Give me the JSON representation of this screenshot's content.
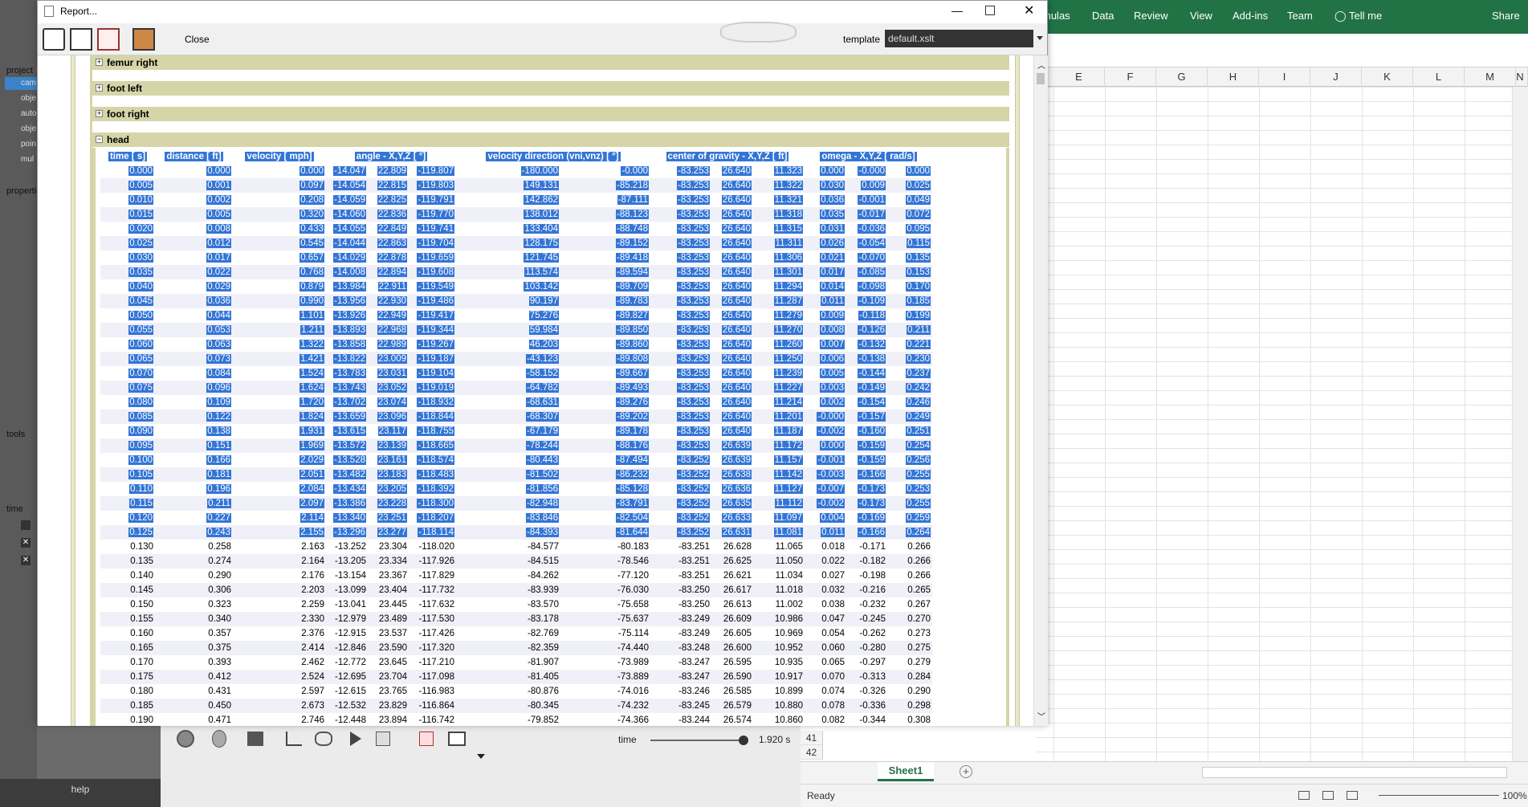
{
  "excel": {
    "tabs": [
      "mulas",
      "Data",
      "Review",
      "View",
      "Add-ins",
      "Team",
      "Tell me",
      "Share"
    ],
    "columns": [
      "E",
      "F",
      "G",
      "H",
      "I",
      "J",
      "K",
      "L",
      "M",
      "N"
    ],
    "row_numbers": [
      "41",
      "42"
    ],
    "sheet_tab": "Sheet1",
    "status": "Ready",
    "zoom": "100%"
  },
  "app": {
    "panel_labels": {
      "project": "project",
      "properties": "properties",
      "tools": "tools",
      "time": "time"
    },
    "project_items": [
      "cam",
      "obje",
      "auto",
      "obje",
      "poin",
      "mul"
    ],
    "help": "help",
    "time_label": "time",
    "time_value": "1.920 s",
    "time_slider_fraction": 0.97
  },
  "dialog": {
    "title": "Report...",
    "close_label": "Close",
    "template_label": "template",
    "template_value": "default.xslt",
    "sections": [
      "femur right",
      "foot left",
      "foot right",
      "head"
    ],
    "headers": [
      "time [ s]",
      "distance [ ft]",
      "velocity [ mph]",
      "angle - X,Y,Z [ °]",
      "velocity direction (vni,vnz) [ °]",
      "center of gravity - X,Y,Z [ ft]",
      "omega - X,Y,Z [ rad/s]"
    ],
    "selected_rows": 26,
    "rows": [
      [
        "0.000",
        "0.000",
        "0.000",
        "-14.047",
        "22.809",
        "-119.807",
        "-180.000",
        "-0.000",
        "-83.253",
        "26.640",
        "11.323",
        "0.000",
        "-0.000",
        "0.000"
      ],
      [
        "0.005",
        "0.001",
        "0.097",
        "-14.054",
        "22.815",
        "-119.803",
        "149.131",
        "-85.218",
        "-83.253",
        "26.640",
        "11.322",
        "0.030",
        "0.009",
        "0.025"
      ],
      [
        "0.010",
        "0.002",
        "0.208",
        "-14.059",
        "22.825",
        "-119.791",
        "142.862",
        "-87.111",
        "-83.253",
        "26.640",
        "11.321",
        "0.036",
        "-0.001",
        "0.049"
      ],
      [
        "0.015",
        "0.005",
        "0.320",
        "-14.060",
        "22.836",
        "-119.770",
        "138.012",
        "-88.123",
        "-83.253",
        "26.640",
        "11.318",
        "0.035",
        "-0.017",
        "0.072"
      ],
      [
        "0.020",
        "0.008",
        "0.433",
        "-14.055",
        "22.849",
        "-119.741",
        "133.404",
        "-88.748",
        "-83.253",
        "26.640",
        "11.315",
        "0.031",
        "-0.036",
        "0.095"
      ],
      [
        "0.025",
        "0.012",
        "0.545",
        "-14.044",
        "22.863",
        "-119.704",
        "128.175",
        "-89.152",
        "-83.253",
        "26.640",
        "11.311",
        "0.026",
        "-0.054",
        "0.115"
      ],
      [
        "0.030",
        "0.017",
        "0.657",
        "-14.029",
        "22.878",
        "-119.659",
        "121.745",
        "-89.418",
        "-83.253",
        "26.640",
        "11.306",
        "0.021",
        "-0.070",
        "0.135"
      ],
      [
        "0.035",
        "0.022",
        "0.768",
        "-14.008",
        "22.894",
        "-119.608",
        "113.574",
        "-89.594",
        "-83.253",
        "26.640",
        "11.301",
        "0.017",
        "-0.085",
        "0.153"
      ],
      [
        "0.040",
        "0.029",
        "0.879",
        "-13.984",
        "22.911",
        "-119.549",
        "103.142",
        "-89.709",
        "-83.253",
        "26.640",
        "11.294",
        "0.014",
        "-0.098",
        "0.170"
      ],
      [
        "0.045",
        "0.036",
        "0.990",
        "-13.956",
        "22.930",
        "-119.486",
        "90.197",
        "-89.783",
        "-83.253",
        "26.640",
        "11.287",
        "0.011",
        "-0.109",
        "0.185"
      ],
      [
        "0.050",
        "0.044",
        "1.101",
        "-13.926",
        "22.949",
        "-119.417",
        "75.276",
        "-89.827",
        "-83.253",
        "26.640",
        "11.279",
        "0.009",
        "-0.118",
        "0.199"
      ],
      [
        "0.055",
        "0.053",
        "1.211",
        "-13.893",
        "22.968",
        "-119.344",
        "59.984",
        "-89.850",
        "-83.253",
        "26.640",
        "11.270",
        "0.008",
        "-0.126",
        "0.211"
      ],
      [
        "0.060",
        "0.063",
        "1.322",
        "-13.858",
        "22.989",
        "-119.267",
        "46.203",
        "-89.860",
        "-83.253",
        "26.640",
        "11.260",
        "0.007",
        "-0.132",
        "0.221"
      ],
      [
        "0.065",
        "0.073",
        "1.421",
        "-13.822",
        "23.009",
        "-119.187",
        "-43.123",
        "-89.808",
        "-83.253",
        "26.640",
        "11.250",
        "0.006",
        "-0.138",
        "0.230"
      ],
      [
        "0.070",
        "0.084",
        "1.524",
        "-13.783",
        "23.031",
        "-119.104",
        "-58.152",
        "-89.667",
        "-83.253",
        "26.640",
        "11.239",
        "0.005",
        "-0.144",
        "0.237"
      ],
      [
        "0.075",
        "0.096",
        "1.624",
        "-13.743",
        "23.052",
        "-119.019",
        "-64.782",
        "-89.493",
        "-83.253",
        "26.640",
        "11.227",
        "0.003",
        "-0.149",
        "0.242"
      ],
      [
        "0.080",
        "0.109",
        "1.720",
        "-13.702",
        "23.074",
        "-118.932",
        "-68.631",
        "-89.276",
        "-83.253",
        "26.640",
        "11.214",
        "0.002",
        "-0.154",
        "0.246"
      ],
      [
        "0.085",
        "0.122",
        "1.824",
        "-13.659",
        "23.096",
        "-118.844",
        "-68.307",
        "-89.202",
        "-83.253",
        "26.640",
        "11.201",
        "-0.000",
        "-0.157",
        "0.249"
      ],
      [
        "0.090",
        "0.138",
        "1.931",
        "-13.615",
        "23.117",
        "-118.755",
        "-67.179",
        "-89.178",
        "-83.253",
        "26.640",
        "11.187",
        "-0.002",
        "-0.160",
        "0.251"
      ],
      [
        "0.095",
        "0.151",
        "1.969",
        "-13.572",
        "23.139",
        "-118.665",
        "-78.244",
        "-88.176",
        "-83.253",
        "26.639",
        "11.172",
        "0.000",
        "-0.159",
        "0.254"
      ],
      [
        "0.100",
        "0.166",
        "2.029",
        "-13.528",
        "23.161",
        "-118.574",
        "-80.443",
        "-87.494",
        "-83.252",
        "26.639",
        "11.157",
        "-0.001",
        "-0.159",
        "0.256"
      ],
      [
        "0.105",
        "0.181",
        "2.051",
        "-13.482",
        "23.183",
        "-118.483",
        "-81.502",
        "-86.232",
        "-83.252",
        "26.638",
        "11.142",
        "-0.003",
        "-0.166",
        "0.255"
      ],
      [
        "0.110",
        "0.196",
        "2.084",
        "-13.434",
        "23.205",
        "-118.392",
        "-81.856",
        "-85.128",
        "-83.252",
        "26.636",
        "11.127",
        "-0.007",
        "-0.173",
        "0.253"
      ],
      [
        "0.115",
        "0.211",
        "2.097",
        "-13.386",
        "23.228",
        "-118.300",
        "-82.948",
        "-83.791",
        "-83.252",
        "26.635",
        "11.112",
        "-0.002",
        "-0.173",
        "0.255"
      ],
      [
        "0.120",
        "0.227",
        "2.114",
        "-13.340",
        "23.251",
        "-118.207",
        "-83.846",
        "-82.504",
        "-83.252",
        "26.633",
        "11.097",
        "0.004",
        "-0.169",
        "0.259"
      ],
      [
        "0.125",
        "0.243",
        "2.155",
        "-13.296",
        "23.277",
        "-118.114",
        "-84.393",
        "-81.644",
        "-83.252",
        "26.631",
        "11.081",
        "0.011",
        "-0.166",
        "0.264"
      ],
      [
        "0.130",
        "0.258",
        "2.163",
        "-13.252",
        "23.304",
        "-118.020",
        "-84.577",
        "-80.183",
        "-83.251",
        "26.628",
        "11.065",
        "0.018",
        "-0.171",
        "0.266"
      ],
      [
        "0.135",
        "0.274",
        "2.164",
        "-13.205",
        "23.334",
        "-117.926",
        "-84.515",
        "-78.546",
        "-83.251",
        "26.625",
        "11.050",
        "0.022",
        "-0.182",
        "0.266"
      ],
      [
        "0.140",
        "0.290",
        "2.176",
        "-13.154",
        "23.367",
        "-117.829",
        "-84.262",
        "-77.120",
        "-83.251",
        "26.621",
        "11.034",
        "0.027",
        "-0.198",
        "0.266"
      ],
      [
        "0.145",
        "0.306",
        "2.203",
        "-13.099",
        "23.404",
        "-117.732",
        "-83.939",
        "-76.030",
        "-83.250",
        "26.617",
        "11.018",
        "0.032",
        "-0.216",
        "0.265"
      ],
      [
        "0.150",
        "0.323",
        "2.259",
        "-13.041",
        "23.445",
        "-117.632",
        "-83.570",
        "-75.658",
        "-83.250",
        "26.613",
        "11.002",
        "0.038",
        "-0.232",
        "0.267"
      ],
      [
        "0.155",
        "0.340",
        "2.330",
        "-12.979",
        "23.489",
        "-117.530",
        "-83.178",
        "-75.637",
        "-83.249",
        "26.609",
        "10.986",
        "0.047",
        "-0.245",
        "0.270"
      ],
      [
        "0.160",
        "0.357",
        "2.376",
        "-12.915",
        "23.537",
        "-117.426",
        "-82.769",
        "-75.114",
        "-83.249",
        "26.605",
        "10.969",
        "0.054",
        "-0.262",
        "0.273"
      ],
      [
        "0.165",
        "0.375",
        "2.414",
        "-12.846",
        "23.590",
        "-117.320",
        "-82.359",
        "-74.440",
        "-83.248",
        "26.600",
        "10.952",
        "0.060",
        "-0.280",
        "0.275"
      ],
      [
        "0.170",
        "0.393",
        "2.462",
        "-12.772",
        "23.645",
        "-117.210",
        "-81.907",
        "-73.989",
        "-83.247",
        "26.595",
        "10.935",
        "0.065",
        "-0.297",
        "0.279"
      ],
      [
        "0.175",
        "0.412",
        "2.524",
        "-12.695",
        "23.704",
        "-117.098",
        "-81.405",
        "-73.889",
        "-83.247",
        "26.590",
        "10.917",
        "0.070",
        "-0.313",
        "0.284"
      ],
      [
        "0.180",
        "0.431",
        "2.597",
        "-12.615",
        "23.765",
        "-116.983",
        "-80.876",
        "-74.016",
        "-83.246",
        "26.585",
        "10.899",
        "0.074",
        "-0.326",
        "0.290"
      ],
      [
        "0.185",
        "0.450",
        "2.673",
        "-12.532",
        "23.829",
        "-116.864",
        "-80.345",
        "-74.232",
        "-83.245",
        "26.579",
        "10.880",
        "0.078",
        "-0.336",
        "0.298"
      ],
      [
        "0.190",
        "0.471",
        "2.746",
        "-12.448",
        "23.894",
        "-116.742",
        "-79.852",
        "-74.366",
        "-83.244",
        "26.574",
        "10.860",
        "0.082",
        "-0.344",
        "0.308"
      ]
    ]
  }
}
